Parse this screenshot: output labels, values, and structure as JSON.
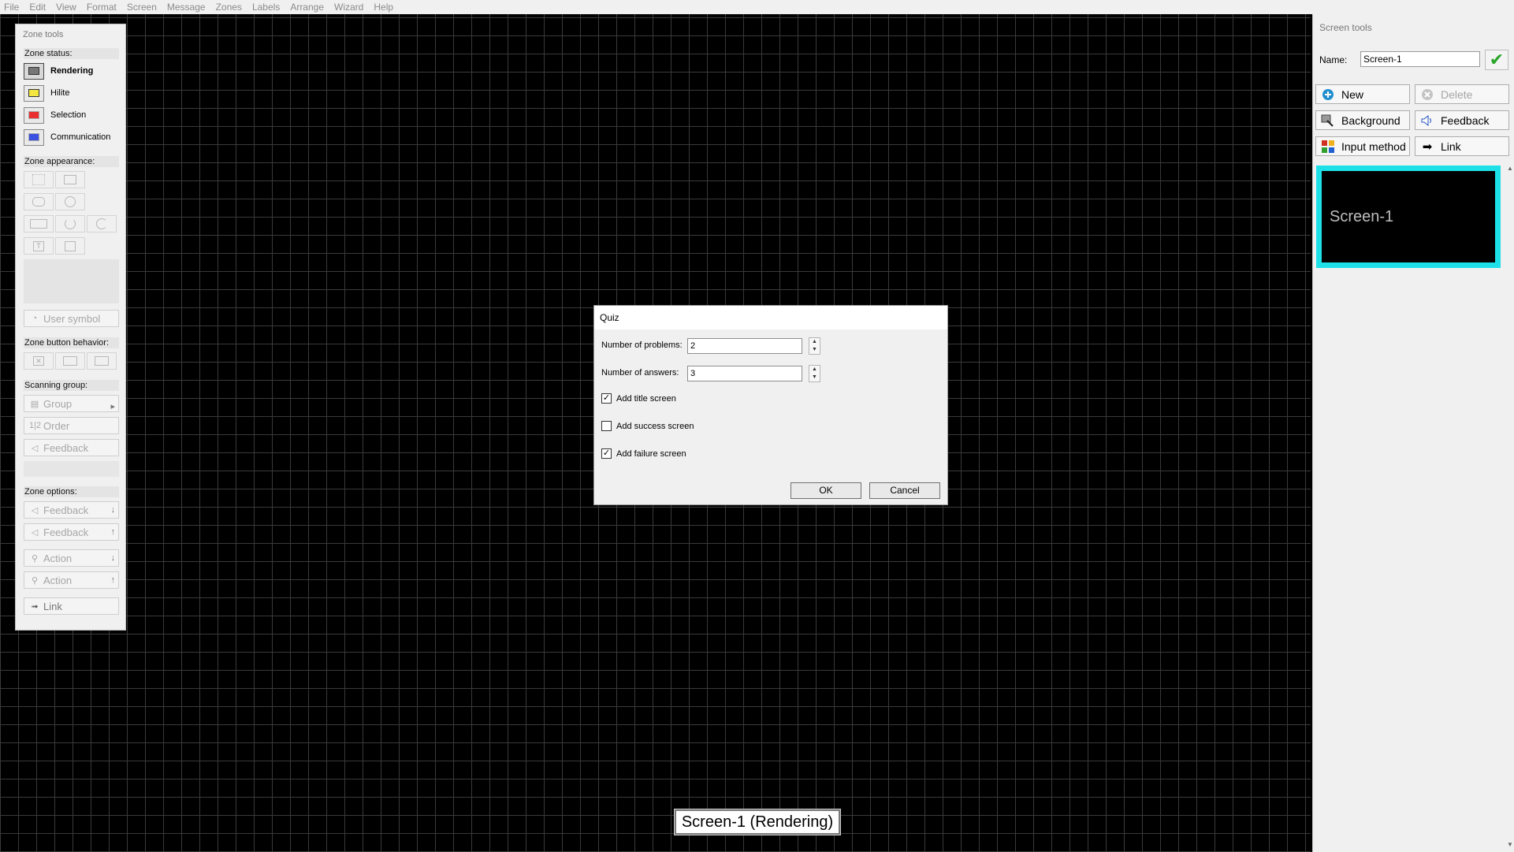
{
  "menu": [
    "File",
    "Edit",
    "View",
    "Format",
    "Screen",
    "Message",
    "Zones",
    "Labels",
    "Arrange",
    "Wizard",
    "Help"
  ],
  "zone_tools": {
    "title": "Zone tools",
    "zone_status_label": "Zone status:",
    "statuses": [
      {
        "label": "Rendering",
        "color": "#555555"
      },
      {
        "label": "Hilite",
        "color": "#f0e020"
      },
      {
        "label": "Selection",
        "color": "#e02020"
      },
      {
        "label": "Communication",
        "color": "#2040e0"
      }
    ],
    "zone_appearance_label": "Zone appearance:",
    "user_symbol": "User symbol",
    "zone_button_behavior_label": "Zone button behavior:",
    "scanning_group_label": "Scanning group:",
    "group": "Group",
    "order": "Order",
    "order_icon": "1|2",
    "feedback": "Feedback",
    "zone_options_label": "Zone options:",
    "feedback_down": "Feedback",
    "feedback_up": "Feedback",
    "action_down": "Action",
    "action_up": "Action",
    "link": "Link"
  },
  "screen_tools": {
    "title": "Screen tools",
    "name_label": "Name:",
    "name_value": "Screen-1",
    "buttons": {
      "new": "New",
      "delete": "Delete",
      "background": "Background",
      "feedback": "Feedback",
      "input_method": "Input method",
      "link": "Link"
    },
    "thumbnail_label": "Screen-1",
    "accent": "#1ee0e8"
  },
  "quiz_dialog": {
    "title": "Quiz",
    "problems_label": "Number of problems:",
    "problems_value": "2",
    "answers_label": "Number of answers:",
    "answers_value": "3",
    "add_title_screen": {
      "label": "Add title screen",
      "checked": true
    },
    "add_success_screen": {
      "label": "Add success screen",
      "checked": false
    },
    "add_failure_screen": {
      "label": "Add failure screen",
      "checked": true
    },
    "ok": "OK",
    "cancel": "Cancel"
  },
  "status_tag": "Screen-1 (Rendering)"
}
